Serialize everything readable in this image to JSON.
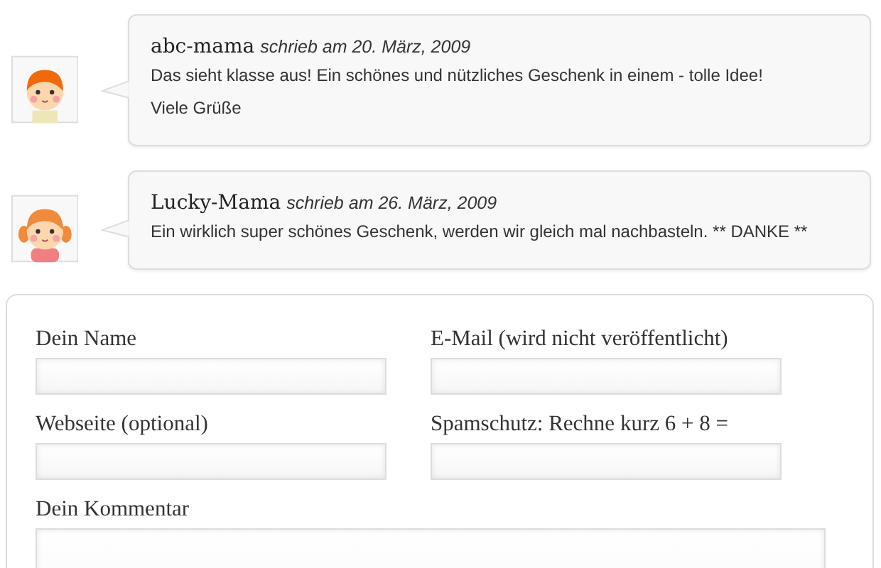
{
  "comments": [
    {
      "author": "abc-mama",
      "meta": "schrieb am 20. März, 2009",
      "kind": "boy",
      "paragraphs": [
        "Das sieht klasse aus! Ein schönes und nützliches Geschenk in einem - tolle Idee!",
        "Viele Grüße"
      ]
    },
    {
      "author": "Lucky-Mama",
      "meta": "schrieb am 26. März, 2009",
      "kind": "girl",
      "paragraphs": [
        "Ein wirklich super schönes Geschenk, werden wir gleich mal nachbasteln. ** DANKE **"
      ]
    }
  ],
  "form": {
    "fields": [
      {
        "label": "Dein Name",
        "kind": "input"
      },
      {
        "label": "E-Mail (wird nicht veröffentlicht)",
        "kind": "input"
      },
      {
        "label": "Webseite (optional)",
        "kind": "input"
      },
      {
        "label": "Spamschutz: Rechne kurz 6 + 8 =",
        "kind": "input"
      },
      {
        "label": "Dein Kommentar",
        "kind": "textarea"
      }
    ]
  }
}
